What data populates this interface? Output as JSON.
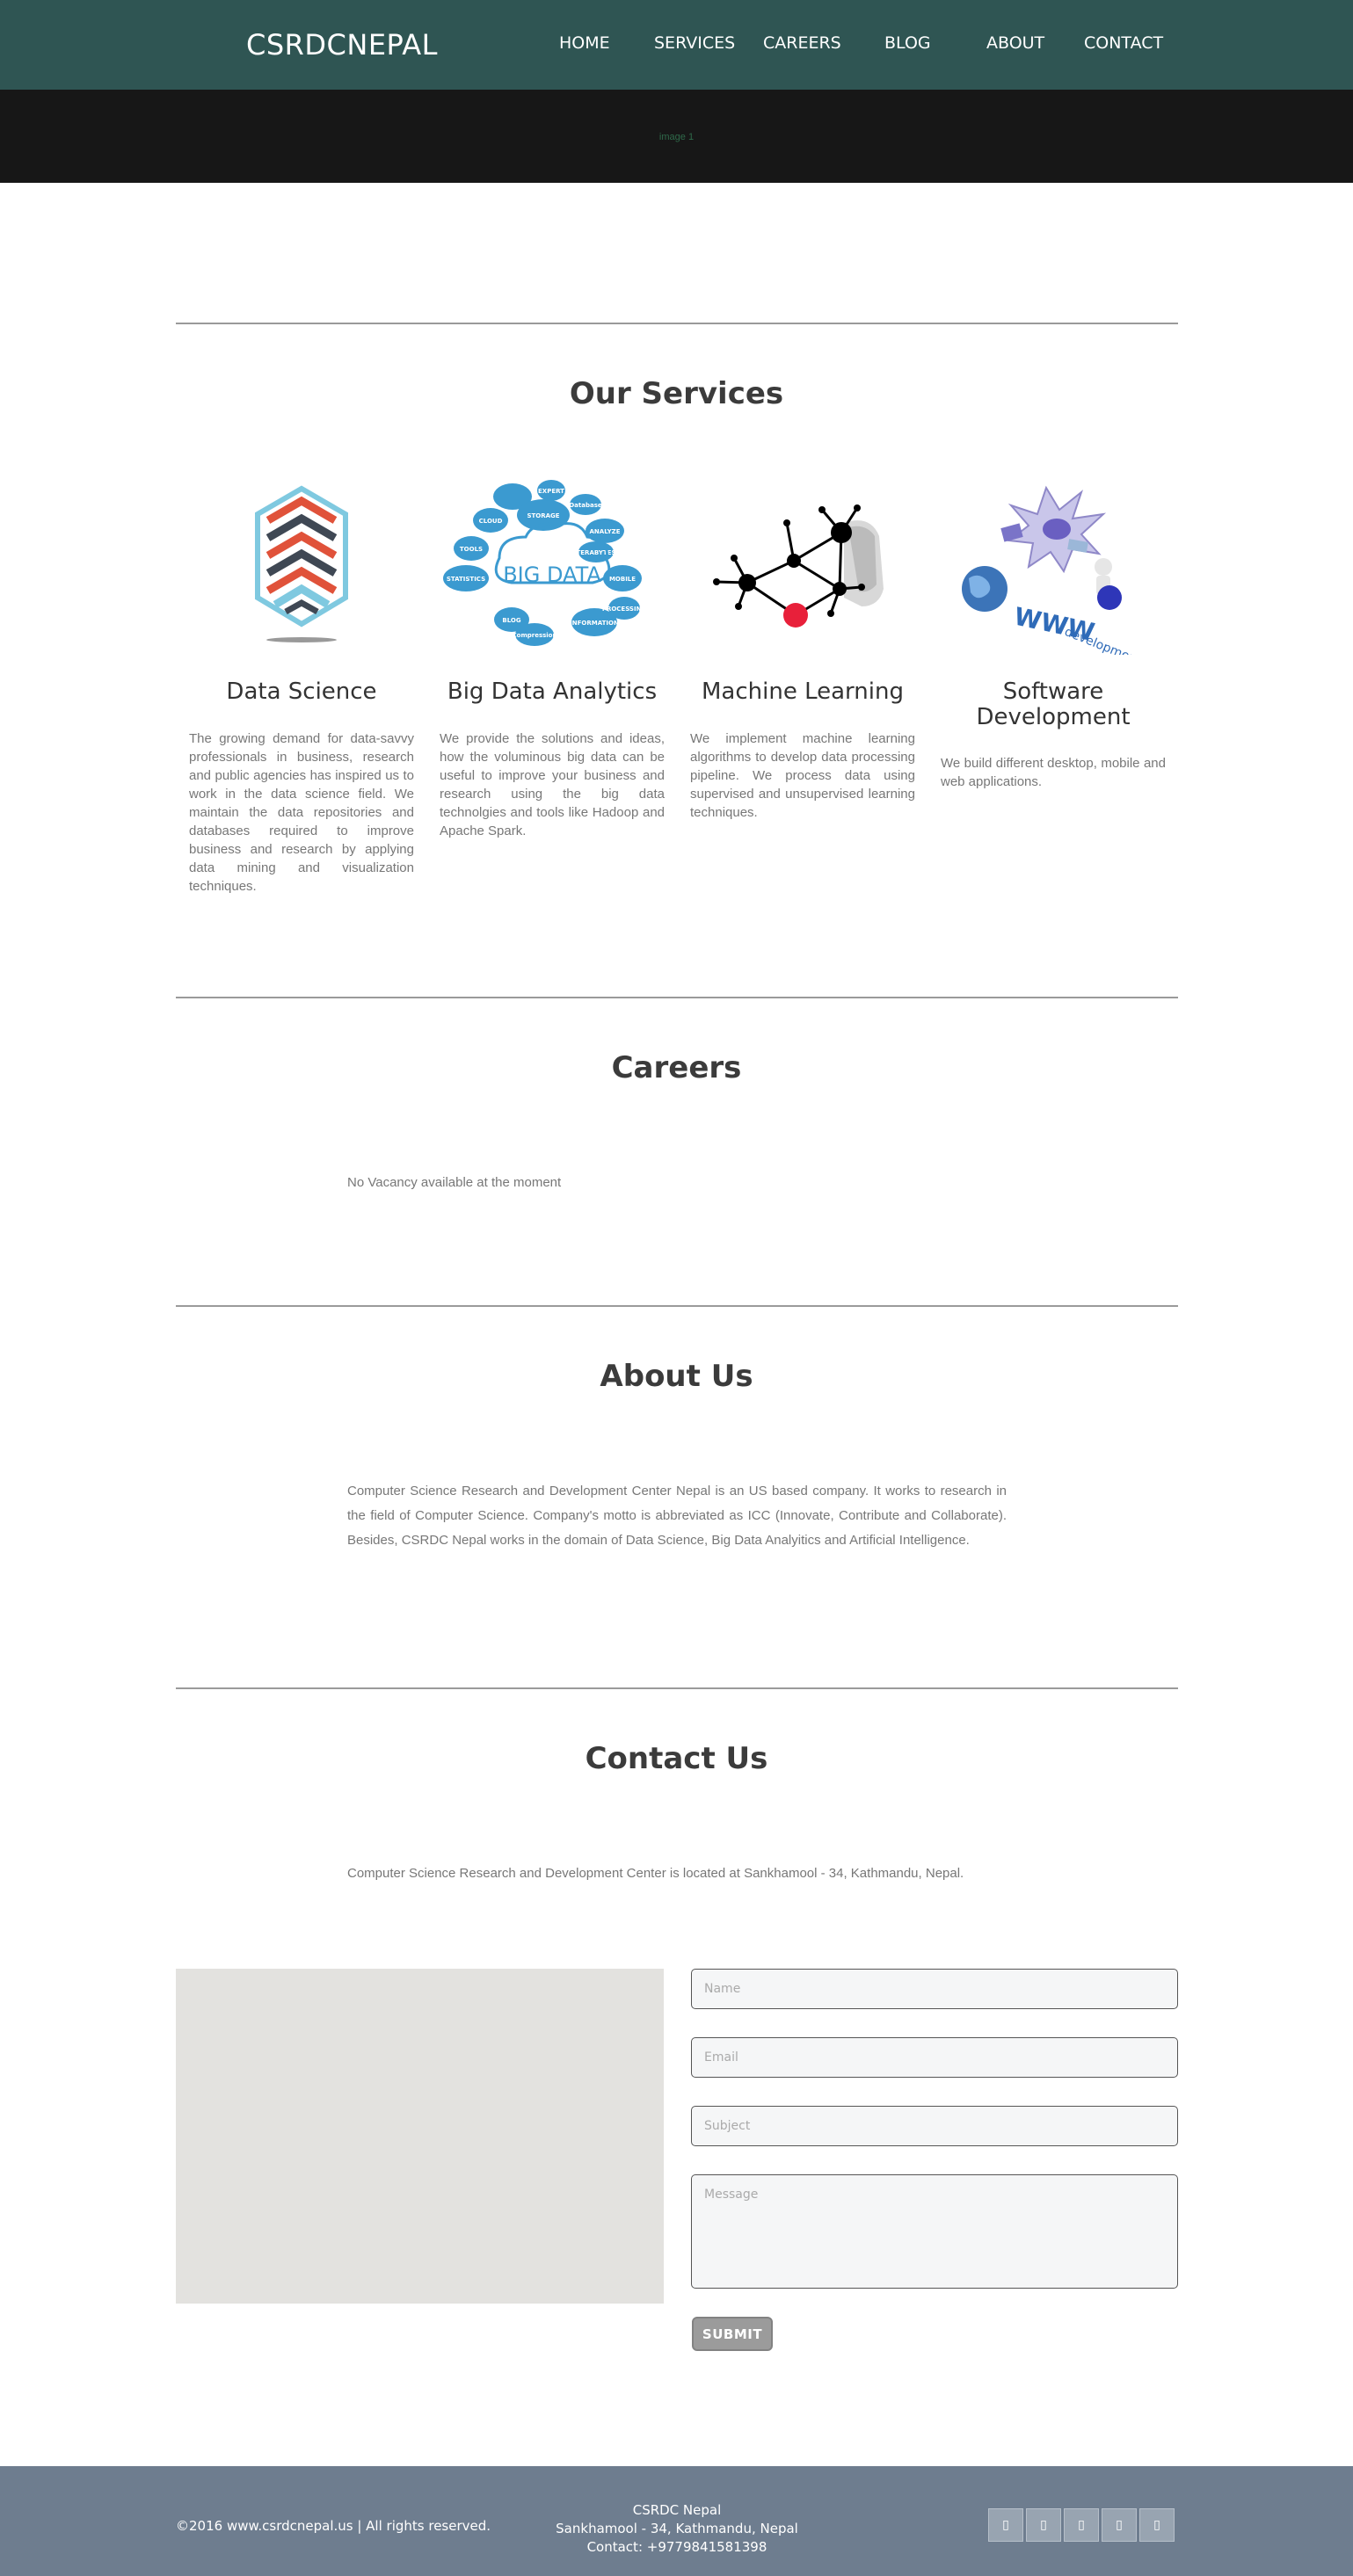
{
  "header": {
    "brand": "CSRDCNEPAL",
    "nav": [
      "HOME",
      "SERVICES",
      "CAREERS",
      "BLOG",
      "ABOUT",
      "CONTACT"
    ]
  },
  "hero": {
    "image_alt": "image 1"
  },
  "services": {
    "title": "Our Services",
    "items": [
      {
        "name": "Data Science",
        "description": "The growing demand for data-savvy professionals in business, research and public agencies has inspired us to work in the data science field. We maintain the data repositories and databases required to improve business and research by applying data mining and visualization techniques.",
        "icon": "data-science-cube-logo"
      },
      {
        "name": "Big Data Analytics",
        "description": "We provide the solutions and ideas, how the voluminous big data can be useful to improve your business and research using the big data technolgies and tools like Hadoop and Apache Spark.",
        "icon": "big-data-clouds",
        "cloud_words": [
          "STORAGE",
          "EXPERT",
          "CLOUD",
          "Database",
          "ANALYZE",
          "TERABYTES",
          "STATISTICS",
          "MOBILE",
          "BIG DATA",
          "TOOLS",
          "INFORMATION",
          "BLOG",
          "Compression",
          "PROCESSING"
        ]
      },
      {
        "name": "Machine Learning",
        "description": "We implement machine learning algorithms to develop data processing pipeline. We process data using supervised and unsupervised learning techniques.",
        "icon": "neural-network-graph"
      },
      {
        "name": "Software Development",
        "description": "We build different desktop, mobile and web applications.",
        "icon": "www-globe-development",
        "graphic_words": [
          "WWW",
          "development"
        ]
      }
    ]
  },
  "careers": {
    "title": "Careers",
    "text": "No Vacancy available at the moment"
  },
  "about": {
    "title": "About Us",
    "text": "Computer Science Research and Development Center Nepal is an US based company. It works to research in the field of Computer Science. Company's motto is abbreviated as ICC (Innovate, Contribute and Collaborate). Besides, CSRDC Nepal works in the domain of Data Science, Big Data Analyitics and Artificial Intelligence."
  },
  "contact": {
    "title": "Contact Us",
    "text": "Computer Science Research and Development Center is located at Sankhamool - 34, Kathmandu, Nepal.",
    "placeholders": {
      "name": "Name",
      "email": "Email",
      "subject": "Subject",
      "message": "Message"
    },
    "submit_label": "SUBMIT"
  },
  "footer": {
    "copyright": "©2016 www.csrdcnepal.us | All rights reserved.",
    "address_lines": [
      "CSRDC Nepal",
      "Sankhamool - 34, Kathmandu, Nepal",
      "Contact: +9779841581398"
    ],
    "social_icons": [
      "social-icon-1",
      "social-icon-2",
      "social-icon-3",
      "social-icon-4",
      "social-icon-5"
    ],
    "social_glyph": "▯"
  },
  "colors": {
    "header_bg": "#2f5553",
    "hero_bg": "#171717",
    "footer_bg": "#6e7d8f",
    "accent_red": "#e0523a",
    "accent_blue": "#3b9ad0",
    "submit_bg": "#9b9b9b"
  }
}
